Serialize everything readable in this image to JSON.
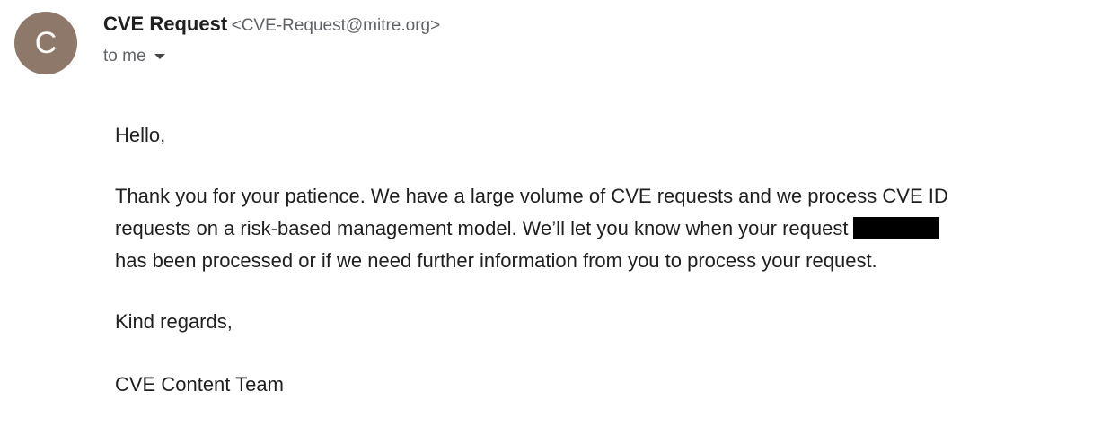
{
  "sender": {
    "avatar_letter": "C",
    "avatar_color": "#8d786a",
    "name": "CVE Request",
    "email": "<CVE-Request@mitre.org>"
  },
  "recipients": {
    "label": "to me"
  },
  "message": {
    "greeting": "Hello,",
    "line1": "Thank you for your patience. We have a large volume of CVE requests and we process CVE ID",
    "line2": "requests on a risk-based management model. We’ll let you know when your request",
    "line3": "has been processed or if we need further information from you to process your request.",
    "closing": "Kind regards,",
    "signature": "CVE Content Team"
  }
}
